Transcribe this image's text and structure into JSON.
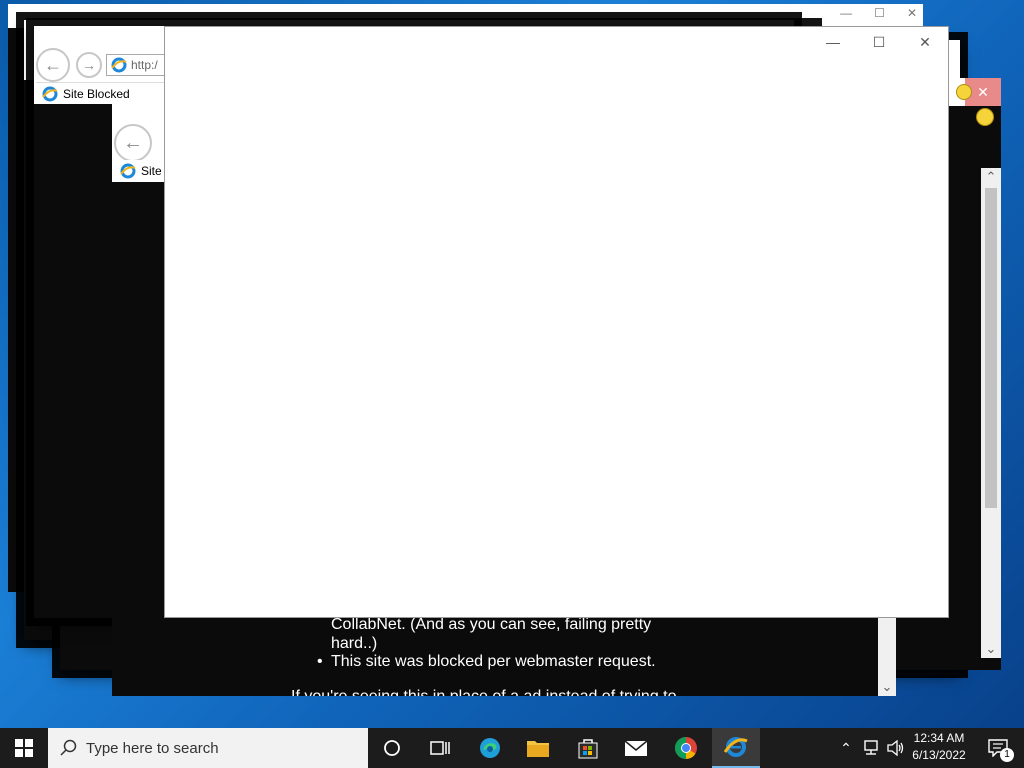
{
  "browser_windows": {
    "tab_title": "Site Blocked",
    "tab_title_partial": "Site B",
    "address_partial": "http:/"
  },
  "window_controls": {
    "minimize": "—",
    "maximize": "☐",
    "close": "✕"
  },
  "blocked_page": {
    "line1": "CollabNet. (And as you can see, failing pretty",
    "line2": "hard..)",
    "bullet": "•",
    "line3": "This site was blocked per webmaster request.",
    "line4": "If you're seeing this in place of a ad instead of trying to"
  },
  "taskbar": {
    "search_placeholder": "Type here to search",
    "time": "12:34 AM",
    "date": "6/13/2022",
    "notification_count": "1"
  },
  "colors": {
    "taskbar": "#1c1c1c",
    "desktop": "#1b7fd6",
    "ie_blue": "#1e88d8",
    "ie_gold": "#f1b51c"
  }
}
